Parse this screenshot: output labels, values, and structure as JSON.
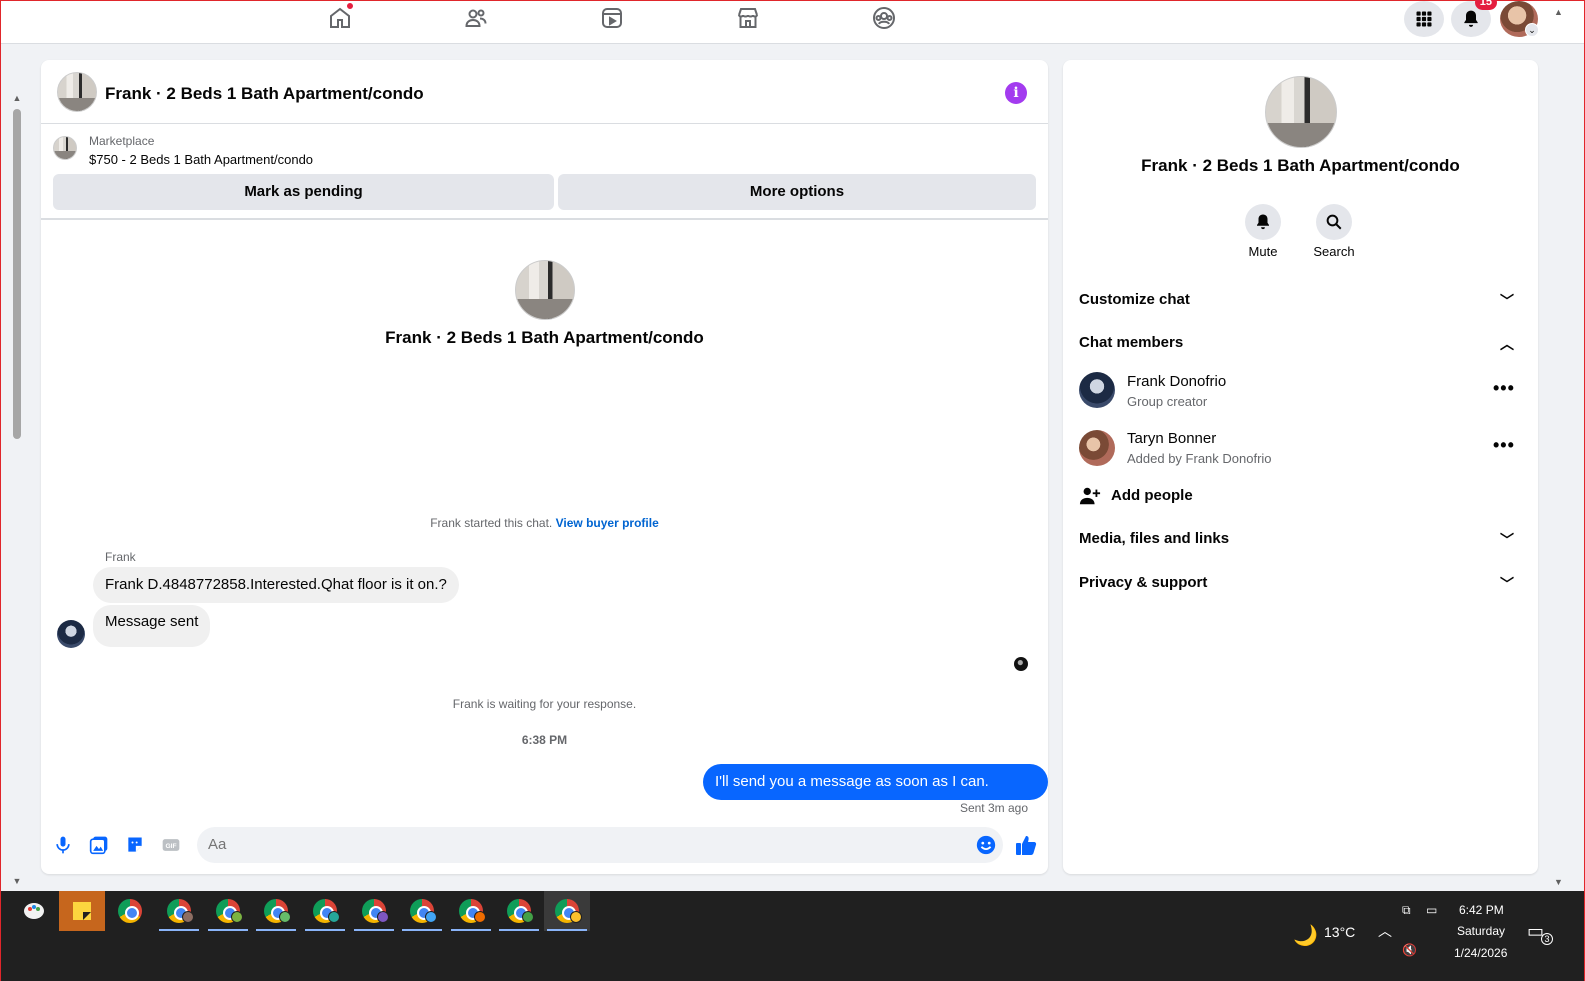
{
  "topnav": {
    "tabs": [
      "home-icon",
      "friends-icon",
      "video-icon",
      "marketplace-icon",
      "groups-icon"
    ],
    "notification_count": "15",
    "colors": {
      "accent": "#0866ff",
      "badge": "#e41e3f"
    }
  },
  "chat": {
    "title": "Frank · 2 Beds 1 Bath Apartment/condo",
    "listing_label": "Marketplace",
    "listing_price": "$750 - 2 Beds 1 Bath Apartment/condo",
    "mark_pending_label": "Mark as pending",
    "more_options_label": "More options",
    "center_title": "Frank · 2 Beds 1 Bath Apartment/condo",
    "started_text": "Frank started this chat.",
    "buyer_profile_link": "View buyer profile",
    "sender_name": "Frank",
    "messages_in": [
      "Frank D.4848772858.Interested.Qhat floor is it on.?",
      "Message sent"
    ],
    "waiting_text": "Frank is waiting for your response.",
    "timestamp": "6:38 PM",
    "message_out": "I'll send you a message as soon as I can. Thanks",
    "sent_status": "Sent 3m ago",
    "composer_placeholder": "Aa"
  },
  "info_panel": {
    "title": "Frank · 2 Beds 1 Bath Apartment/condo",
    "mute_label": "Mute",
    "search_label": "Search",
    "customize_chat": "Customize chat",
    "chat_members": "Chat members",
    "members": [
      {
        "name": "Frank Donofrio",
        "subtitle": "Group creator"
      },
      {
        "name": "Taryn Bonner",
        "subtitle": "Added by Frank Donofrio"
      }
    ],
    "add_people": "Add people",
    "media_files_links": "Media, files and links",
    "privacy_support": "Privacy & support"
  },
  "taskbar": {
    "weather": "13°C",
    "time": "6:42 PM",
    "day": "Saturday",
    "date": "1/24/2026",
    "notification_count": "3"
  }
}
